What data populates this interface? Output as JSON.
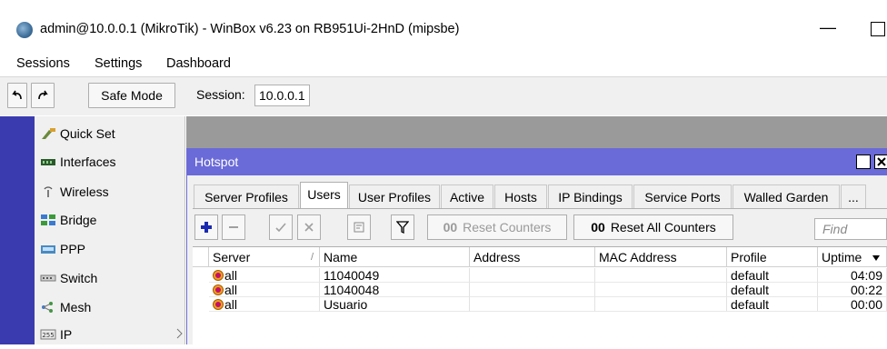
{
  "window": {
    "title": "admin@10.0.0.1 (MikroTik) - WinBox v6.23 on RB951Ui-2HnD (mipsbe)",
    "minimize_glyph": "—"
  },
  "menu": [
    "Sessions",
    "Settings",
    "Dashboard"
  ],
  "toolbar": {
    "undo_icon": "undo-icon",
    "redo_icon": "redo-icon",
    "safe_mode": "Safe Mode",
    "session_label": "Session:",
    "session_value": "10.0.0.1"
  },
  "sidebar": {
    "items": [
      {
        "label": "Quick Set",
        "icon": "quick-set-icon"
      },
      {
        "label": "Interfaces",
        "icon": "interfaces-icon"
      },
      {
        "label": "Wireless",
        "icon": "wireless-icon"
      },
      {
        "label": "Bridge",
        "icon": "bridge-icon"
      },
      {
        "label": "PPP",
        "icon": "ppp-icon"
      },
      {
        "label": "Switch",
        "icon": "switch-icon"
      },
      {
        "label": "Mesh",
        "icon": "mesh-icon"
      },
      {
        "label": "IP",
        "icon": "ip-icon"
      }
    ]
  },
  "hotspot": {
    "title": "Hotspot",
    "tabs": [
      "Server Profiles",
      "Users",
      "User Profiles",
      "Active",
      "Hosts",
      "IP Bindings",
      "Service Ports",
      "Walled Garden",
      "..."
    ],
    "active_tab": "Users",
    "tools": {
      "reset_counters": "Reset Counters",
      "reset_all_counters": "Reset All Counters",
      "counter_glyph": "00",
      "find_placeholder": "Find"
    },
    "columns": [
      "Server",
      "Name",
      "Address",
      "MAC Address",
      "Profile",
      "Uptime"
    ],
    "sort_glyph": "/",
    "rows": [
      {
        "server": "all",
        "name": "11040049",
        "address": "",
        "mac": "",
        "profile": "default",
        "uptime": "04:09"
      },
      {
        "server": "all",
        "name": "11040048",
        "address": "",
        "mac": "",
        "profile": "default",
        "uptime": "00:22"
      },
      {
        "server": "all",
        "name": "Usuario",
        "address": "",
        "mac": "",
        "profile": "default",
        "uptime": "00:00"
      }
    ]
  },
  "colors": {
    "sidebar_strip": "#3b3bb0",
    "hotspot_title_bar": "#6a6ad8",
    "workspace": "#9a9a9a"
  }
}
